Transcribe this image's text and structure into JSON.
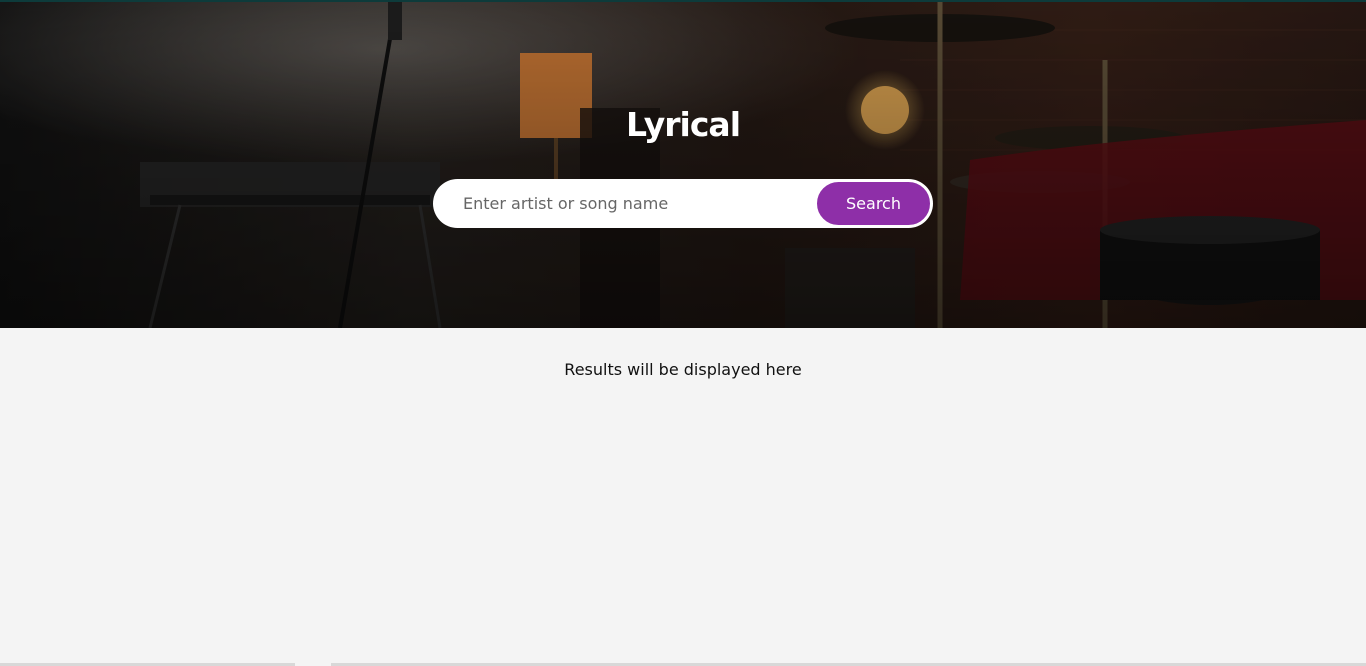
{
  "header": {
    "title": "Lyrical"
  },
  "search": {
    "placeholder": "Enter artist or song name",
    "value": "",
    "button_label": "Search"
  },
  "results": {
    "message": "Results will be displayed here"
  },
  "colors": {
    "accent": "#8e2fa8",
    "page_background": "#f4f4f4"
  }
}
